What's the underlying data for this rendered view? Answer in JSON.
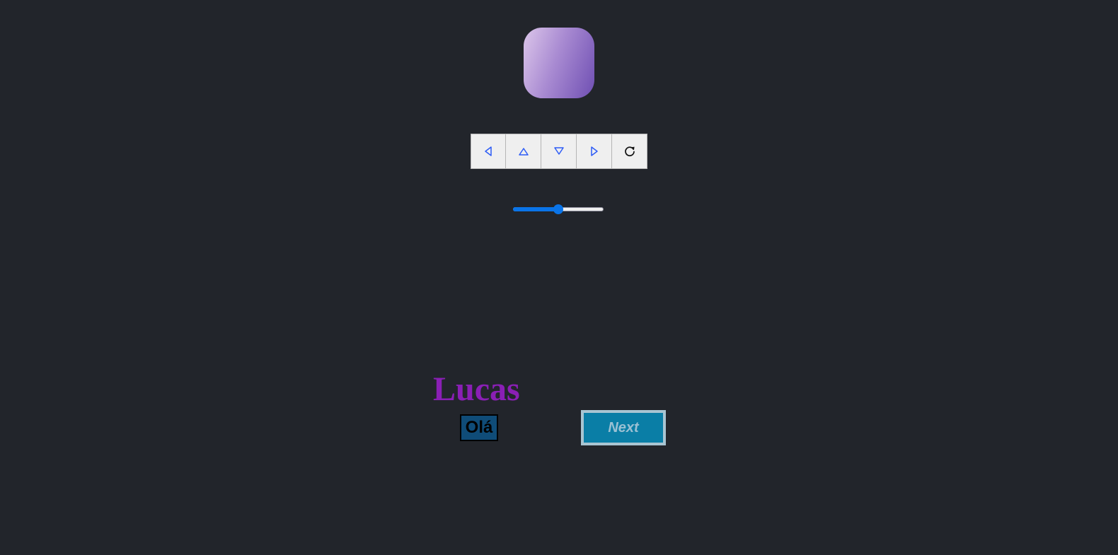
{
  "shape": {
    "gradient_colors": [
      "#dcc6ea",
      "#a98bd2",
      "#6f4fb3"
    ]
  },
  "controls": [
    {
      "name": "move-left-button",
      "icon": "triangle-left-icon"
    },
    {
      "name": "move-up-button",
      "icon": "triangle-up-icon"
    },
    {
      "name": "move-down-button",
      "icon": "triangle-down-icon"
    },
    {
      "name": "move-right-button",
      "icon": "triangle-right-icon"
    },
    {
      "name": "reset-button",
      "icon": "refresh-icon"
    }
  ],
  "slider": {
    "value_fraction": 0.5,
    "accent_color": "#0a74e8"
  },
  "greeting": {
    "name": "Lucas",
    "hello": "Olá"
  },
  "next_button": {
    "label": "Next"
  }
}
